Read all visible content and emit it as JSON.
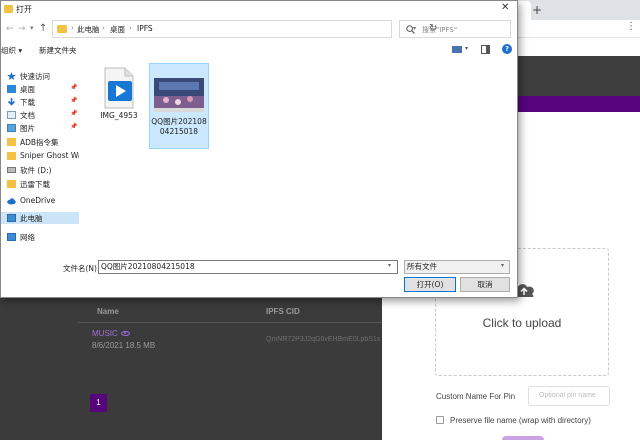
{
  "dialog": {
    "title": "打开",
    "close_glyph": "✕",
    "breadcrumbs": [
      "此电脑",
      "桌面",
      "IPFS"
    ],
    "crumb_sep": "›",
    "search_placeholder": "搜索\"IPFS\"",
    "organize": "组织 ▾",
    "new_folder": "新建文件夹",
    "help_glyph": "?",
    "nav_items": [
      {
        "label": "快速访问",
        "icon": "star-icon",
        "pinned": false
      },
      {
        "label": "桌面",
        "icon": "desktop-icon",
        "pinned": true
      },
      {
        "label": "下载",
        "icon": "download-icon",
        "pinned": true
      },
      {
        "label": "文档",
        "icon": "document-icon",
        "pinned": true
      },
      {
        "label": "图片",
        "icon": "pictures-icon",
        "pinned": true
      },
      {
        "label": "ADB指令集",
        "icon": "folder-icon",
        "pinned": false
      },
      {
        "label": "Sniper Ghost War",
        "icon": "folder-icon",
        "pinned": false
      },
      {
        "label": "软件 (D:)",
        "icon": "drive-icon",
        "pinned": false
      },
      {
        "label": "迅雷下载",
        "icon": "folder-icon",
        "pinned": false
      },
      {
        "label": "OneDrive",
        "icon": "cloud-icon",
        "pinned": false
      },
      {
        "label": "此电脑",
        "icon": "computer-icon",
        "pinned": false,
        "selected": true
      },
      {
        "label": "网络",
        "icon": "network-icon",
        "pinned": false
      }
    ],
    "files": [
      {
        "name": "IMG_4953",
        "kind": "video"
      },
      {
        "name": "QQ图片20210804215018",
        "kind": "image",
        "selected": true
      }
    ],
    "filename_label": "文件名(N):",
    "filename_value": "QQ图片20210804215018",
    "filetype_value": "所有文件",
    "open_button": "打开(O)",
    "cancel_button": "取消"
  },
  "page": {
    "table_headers": {
      "name": "Name",
      "cid": "IPFS CID"
    },
    "row": {
      "name": "MUSIC",
      "date": "8/6/2021",
      "size": "18.5 MB",
      "cid": "QmNR72P3J2qG6vEHBmE0LpbS1s"
    },
    "page_number": "1",
    "upload_text": "Click to upload",
    "custom_name_label": "Custom Name For Pin",
    "pin_placeholder": "Optional pin name",
    "preserve_label": "Preserve file name (wrap with directory)"
  },
  "colors": {
    "purple": "#56047b",
    "accent_link": "#9d6fd9",
    "selection": "#cce8ff"
  }
}
